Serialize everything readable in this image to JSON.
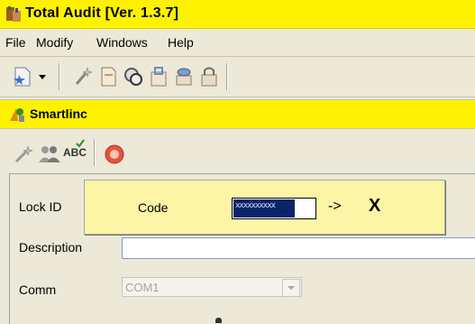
{
  "window": {
    "title": "Total Audit  [Ver. 1.3.7]",
    "title_bg": "#fff200",
    "icon": "total-audit-app-icon"
  },
  "menu": [
    "File",
    "Modify",
    "Windows",
    "Help"
  ],
  "toolbar": {
    "buttons": [
      "new-audit-icon",
      "dropdown-arrow-icon",
      "wand-icon",
      "document-icon",
      "magnifier-lock-icon",
      "lock-doc-icon",
      "stack-icon",
      "padlock-icon"
    ]
  },
  "child_window": {
    "title": "Smartlinc",
    "icon": "smartlinc-icon"
  },
  "child_toolbar": {
    "buttons": [
      "wand-icon",
      "users-icon",
      "spellcheck-icon",
      "alert-icon"
    ],
    "spellcheck_label": "ABC"
  },
  "form": {
    "lock_id_label": "Lock ID",
    "description_label": "Description",
    "comm_label": "Comm",
    "comm_value": "COM1"
  },
  "code_popup": {
    "label": "Code",
    "masked_value": "xxxxxxxxxx",
    "arrow": "->",
    "close": "X",
    "bg": "#fdf5a6"
  }
}
